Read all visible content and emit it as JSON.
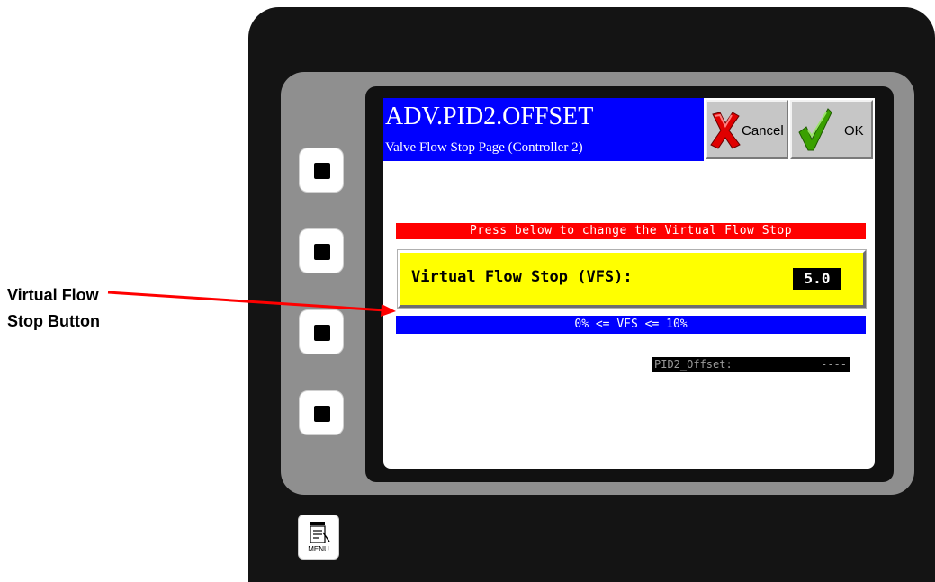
{
  "callout": {
    "line1": "Virtual Flow",
    "line2": "Stop Button"
  },
  "header": {
    "title": "ADV.PID2.OFFSET",
    "subtitle": "Valve Flow Stop Page (Controller 2)"
  },
  "toolbar": {
    "cancel_label": "Cancel",
    "ok_label": "OK"
  },
  "main": {
    "instruction": "Press below to change the Virtual Flow Stop",
    "vfs_label": "Virtual Flow Stop (VFS):",
    "vfs_value": "5.0",
    "range_text": "0% <= VFS <= 10%",
    "pid_offset_label": "PID2_Offset:",
    "pid_offset_value": "----"
  },
  "hardware": {
    "menu_label": "MENU"
  },
  "colors": {
    "title_bar": "#0000ff",
    "instruction_bar": "#ff0000",
    "vfs_button": "#ffff00",
    "range_bar": "#0000ff",
    "arrow": "#ff0000"
  },
  "icons": [
    "x-icon",
    "checkmark-icon",
    "menu-doc-icon",
    "arrow-icon"
  ]
}
